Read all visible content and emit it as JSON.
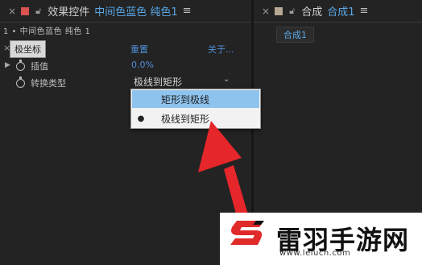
{
  "left_panel": {
    "tab": {
      "close_glyph": "×",
      "swatch_color": "#d9534f",
      "title": "效果控件",
      "subtitle": "中间色蓝色 纯色1",
      "menu_glyph": "≡"
    },
    "breadcrumb": "1 • 中间色蓝色 纯色 1",
    "effect": {
      "tooltip": "极坐标",
      "close_glyph": "×",
      "reset_label": "重置",
      "about_label": "关于..."
    },
    "params": [
      {
        "label": "插值",
        "value": "0.0%"
      },
      {
        "label": "转换类型",
        "value": "极线到矩形"
      }
    ],
    "dropdown_chevron": "⌄",
    "popup": {
      "options": [
        {
          "label": "矩形到极线",
          "selected": false,
          "highlighted": true
        },
        {
          "label": "极线到矩形",
          "selected": true,
          "highlighted": false
        }
      ],
      "bullet": "●"
    }
  },
  "right_panel": {
    "tab": {
      "close_glyph": "×",
      "swatch_color": "#b8a892",
      "title": "合成",
      "subtitle": "合成1",
      "menu_glyph": "≡"
    },
    "comp_tab": "合成1"
  },
  "watermark": {
    "name": "雷羽手游网",
    "url": "www.leiucn.com",
    "accent_color": "#e02a2a"
  },
  "colors": {
    "accent_blue": "#4f8fd8",
    "arrow_red": "#e5262a"
  }
}
